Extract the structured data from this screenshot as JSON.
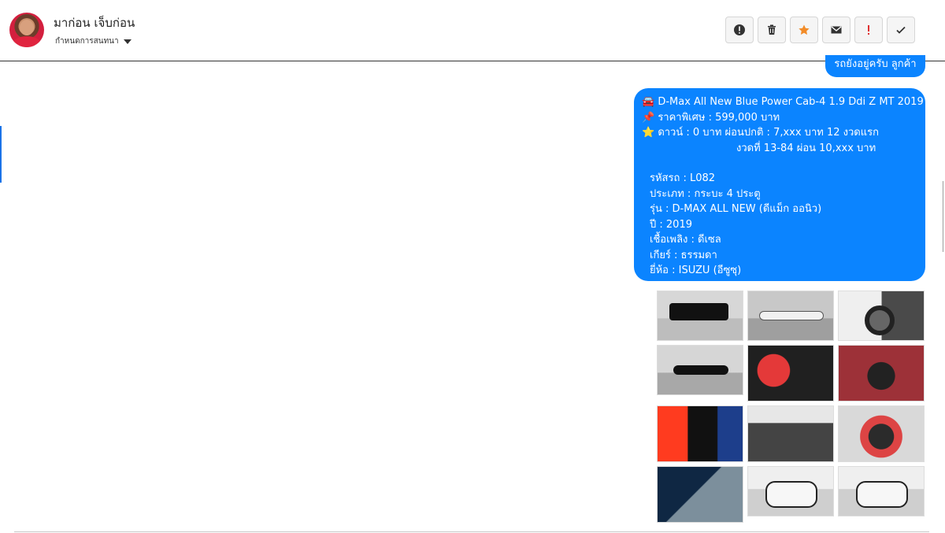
{
  "header": {
    "name": "มาก่อน เจ็บก่อน",
    "assign_label": "กำหนดการสนทนา"
  },
  "actions": [
    "alert-circle",
    "trash",
    "star",
    "mail",
    "exclamation",
    "check"
  ],
  "messages": {
    "small_bubble": "รถยังอยู่ครับ ลูกค้า",
    "title": "🚘 D-Max All New Blue Power Cab-4 1.9 Ddi Z MT 2019",
    "price": "📌 ราคาพิเศษ : 599,000 บาท",
    "down": "⭐ ดาวน์ : 0 บาท ผ่อนปกติ : 7,xxx บาท 12 งวดแรก",
    "installment": "งวดที่ 13-84 ผ่อน 10,xxx บาท",
    "details": [
      "รหัสรถ : L082",
      "ประเภท : กระบะ 4 ประตู",
      "รุ่น : D-MAX ALL NEW (ดีแม็ก ออนิว)",
      "ปี : 2019",
      "เชื้อเพลิง : ดีเซล",
      "เกียร์ : ธรรมดา",
      "ยี่ห้อ : ISUZU (อีซูซุ)"
    ]
  },
  "thumbnails": [
    "car-rear-view-image",
    "car-side-view-image",
    "car-wheel-image",
    "car-side-view-image",
    "interior-seat-image",
    "interior-dashboard-image",
    "gear-shift-image",
    "center-console-image",
    "steering-wheel-image",
    "door-panel-image",
    "car-front-view-image",
    "car-front-view-image"
  ]
}
